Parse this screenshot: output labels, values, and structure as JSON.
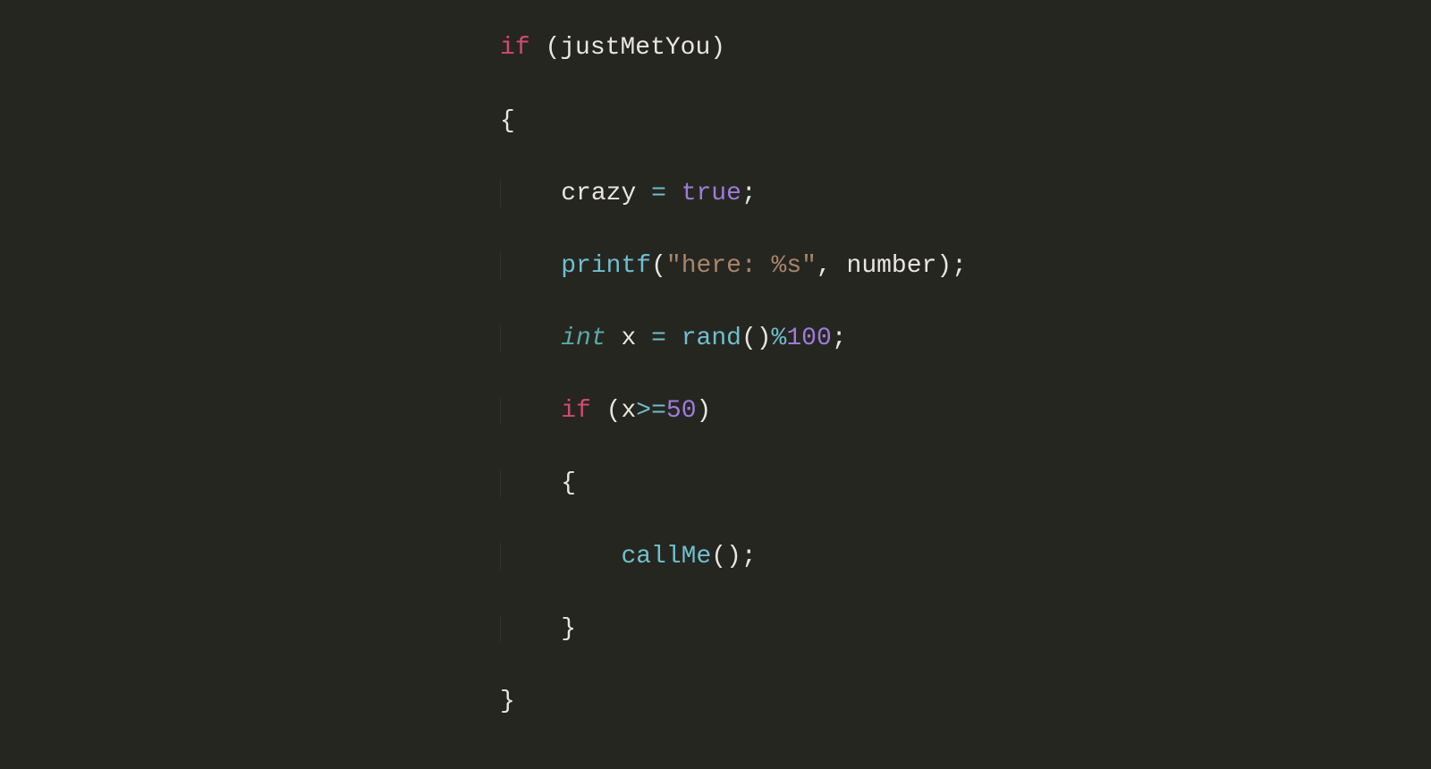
{
  "code": {
    "line1": {
      "keyword": "if",
      "rest": " (justMetYou)"
    },
    "line2": {
      "brace": "{"
    },
    "line3": {
      "indent": "    ",
      "var": "crazy ",
      "op": "=",
      "space": " ",
      "bool": "true",
      "semi": ";"
    },
    "line4": {
      "indent": "    ",
      "func": "printf",
      "paren_open": "(",
      "string": "\"here: %s\"",
      "rest": ", number);"
    },
    "line5": {
      "indent": "    ",
      "type": "int",
      "var": " x ",
      "op": "=",
      "space": " ",
      "func": "rand",
      "parens": "()",
      "mod": "%",
      "num": "100",
      "semi": ";"
    },
    "line6": {
      "indent": "    ",
      "keyword": "if",
      "open": " (x",
      "op": ">=",
      "num": "50",
      "close": ")"
    },
    "line7": {
      "indent": "    ",
      "brace": "{"
    },
    "line8": {
      "indent": "        ",
      "func": "callMe",
      "rest": "();"
    },
    "line9": {
      "indent": "    ",
      "brace": "}"
    },
    "line10": {
      "brace": "}"
    }
  }
}
